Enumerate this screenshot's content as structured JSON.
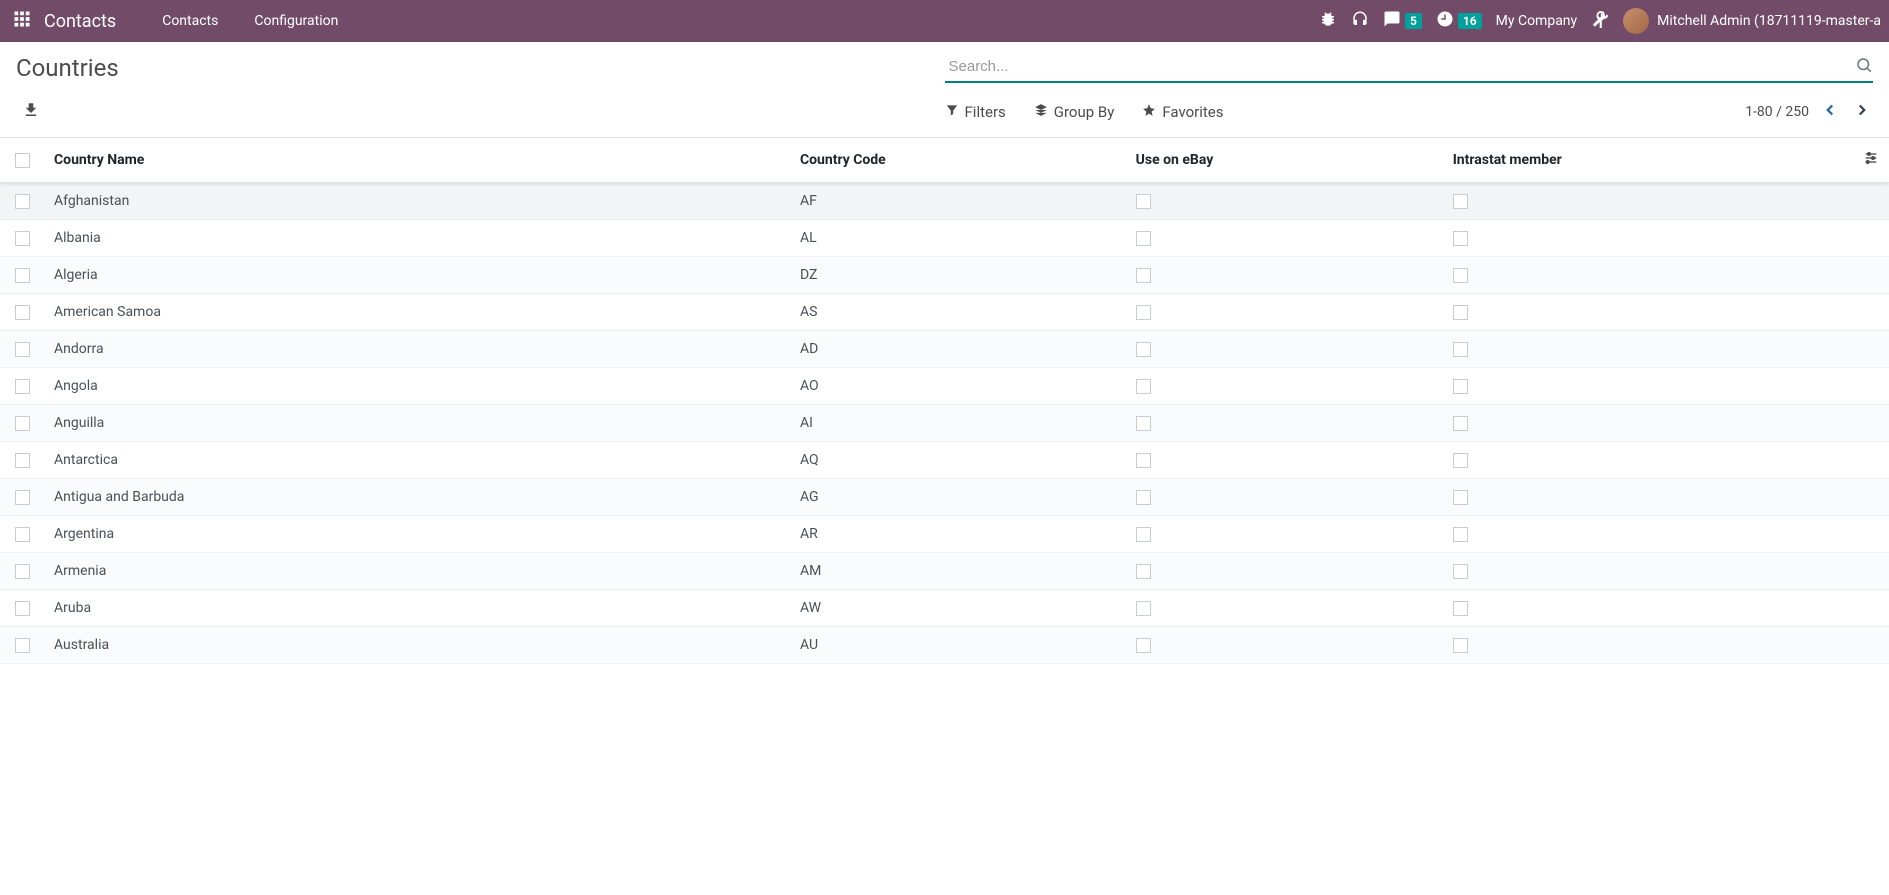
{
  "colors": {
    "brand": "#714b67",
    "accent": "#017e84",
    "badge": "#00a09d"
  },
  "topbar": {
    "app_title": "Contacts",
    "nav": [
      "Contacts",
      "Configuration"
    ],
    "company": "My Company",
    "user": "Mitchell Admin (18711119-master-a",
    "messaging_badge": "5",
    "activities_badge": "16"
  },
  "page": {
    "title": "Countries",
    "search_placeholder": "Search..."
  },
  "tools": {
    "filters": "Filters",
    "group_by": "Group By",
    "favorites": "Favorites"
  },
  "pager": {
    "text": "1-80 / 250"
  },
  "columns": {
    "name": "Country Name",
    "code": "Country Code",
    "ebay": "Use on eBay",
    "intrastat": "Intrastat member"
  },
  "rows": [
    {
      "name": "Afghanistan",
      "code": "AF",
      "ebay": false,
      "intrastat": false
    },
    {
      "name": "Albania",
      "code": "AL",
      "ebay": false,
      "intrastat": false
    },
    {
      "name": "Algeria",
      "code": "DZ",
      "ebay": false,
      "intrastat": false
    },
    {
      "name": "American Samoa",
      "code": "AS",
      "ebay": false,
      "intrastat": false
    },
    {
      "name": "Andorra",
      "code": "AD",
      "ebay": false,
      "intrastat": false
    },
    {
      "name": "Angola",
      "code": "AO",
      "ebay": false,
      "intrastat": false
    },
    {
      "name": "Anguilla",
      "code": "AI",
      "ebay": false,
      "intrastat": false
    },
    {
      "name": "Antarctica",
      "code": "AQ",
      "ebay": false,
      "intrastat": false
    },
    {
      "name": "Antigua and Barbuda",
      "code": "AG",
      "ebay": false,
      "intrastat": false
    },
    {
      "name": "Argentina",
      "code": "AR",
      "ebay": false,
      "intrastat": false
    },
    {
      "name": "Armenia",
      "code": "AM",
      "ebay": false,
      "intrastat": false
    },
    {
      "name": "Aruba",
      "code": "AW",
      "ebay": false,
      "intrastat": false
    },
    {
      "name": "Australia",
      "code": "AU",
      "ebay": false,
      "intrastat": false
    }
  ]
}
